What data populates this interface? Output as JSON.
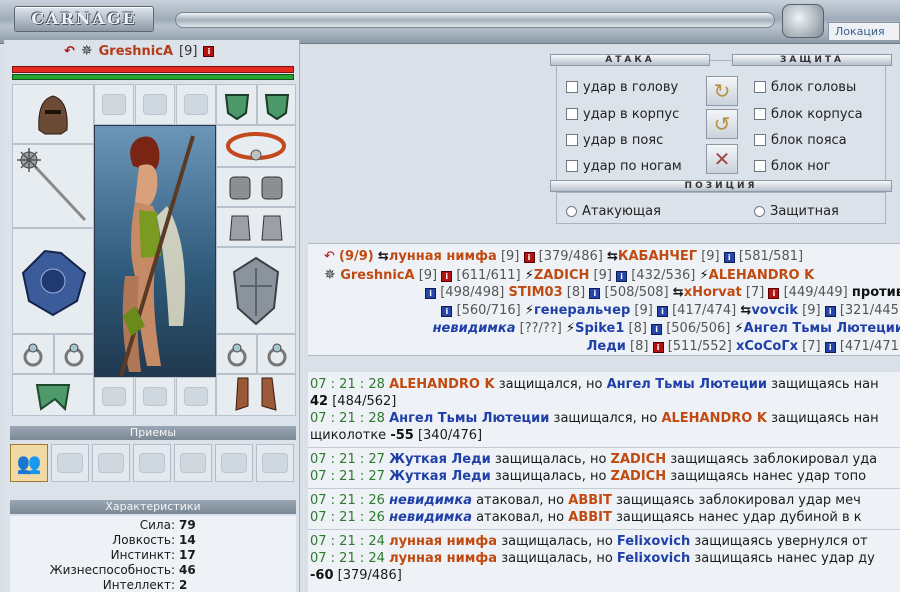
{
  "header": {
    "logo_text": "CARNAGE",
    "location_tab": "Локация"
  },
  "player": {
    "nick": "GreshnicA",
    "level": "[9]",
    "info_icon": "info-icon"
  },
  "tricks": {
    "title": "Приемы"
  },
  "stats": {
    "title": "Характеристики",
    "items": [
      {
        "name": "Сила:",
        "value": "79"
      },
      {
        "name": "Ловкость:",
        "value": "14"
      },
      {
        "name": "Инстинкт:",
        "value": "17"
      },
      {
        "name": "Жизнеспособность:",
        "value": "46"
      },
      {
        "name": "Интеллект:",
        "value": "2"
      }
    ]
  },
  "combat": {
    "attack_title": "АТАКА",
    "defense_title": "ЗАЩИТА",
    "position_title": "ПОЗИЦИЯ",
    "attacks": [
      "удар в голову",
      "удар в корпус",
      "удар в пояс",
      "удар по ногам"
    ],
    "blocks": [
      "блок головы",
      "блок корпуса",
      "блок пояса",
      "блок ног"
    ],
    "positions": [
      "Атакующая",
      "Защитная"
    ]
  },
  "participants": {
    "count": "(9/9)",
    "rows": [
      [
        "лунная нимфа",
        "[9]",
        "[379/486]",
        "КАБАНЧЕГ",
        "[9]",
        "[581/581]"
      ],
      [
        "GreshnicA",
        "[9]",
        "[611/611]",
        "ZADICH",
        "[9]",
        "[432/536]",
        "ALEHANDRO K"
      ],
      [
        "[498/498]",
        "STIM03",
        "[8]",
        "[508/508]",
        "xHorvat",
        "[7]",
        "[449/449]",
        "против"
      ],
      [
        "[560/716]",
        "генеральчер",
        "[9]",
        "[417/474]",
        "vovcik",
        "[9]",
        "[321/445]"
      ],
      [
        "невидимка",
        "[??/??]",
        "Spike1",
        "[8]",
        "[506/506]",
        "Ангел Тьмы Лютеции"
      ],
      [
        "Леди",
        "[8]",
        "[511/552]",
        "xCoCoГx",
        "[7]",
        "[471/471]"
      ]
    ]
  },
  "log": [
    {
      "time": "07 : 21 : 28",
      "a": "ALEHANDRO K",
      "t1": " защищался, но ",
      "b": "Ангел Тьмы Лютеции",
      "t2": " защищаясь нан"
    },
    {
      "line2": "42",
      "line2b": " [484/562]"
    },
    {
      "time": "07 : 21 : 28",
      "a": "Ангел Тьмы Лютеции",
      "t1": " защищался, но ",
      "b": "ALEHANDRO K",
      "t2": " защищаясь нан"
    },
    {
      "line2": "щиколотке ",
      "dmg": "-55",
      "line2b": " [340/476]"
    },
    {
      "time": "07 : 21 : 27",
      "a": "Жуткая Леди",
      "t1": " защищалась, но ",
      "b": "ZADICH",
      "t2": " защищаясь заблокировал уда"
    },
    {
      "time": "07 : 21 : 27",
      "a": "Жуткая Леди",
      "t1": " защищалась, но ",
      "b": "ZADICH",
      "t2": " защищаясь нанес удар топо"
    },
    {
      "time": "07 : 21 : 26",
      "a": "невидимка",
      "t1": " атаковал, но ",
      "b": "ABBIT",
      "t2": " защищаясь заблокировал удар меч"
    },
    {
      "time": "07 : 21 : 26",
      "a": "невидимка",
      "t1": " атаковал, но ",
      "b": "ABBIT",
      "t2": " защищаясь нанес удар дубиной в к"
    },
    {
      "time": "07 : 21 : 24",
      "a": "лунная нимфа",
      "t1": " защищалась, но ",
      "b": "Felixovich",
      "t2": " защищаясь увернулся от"
    },
    {
      "time": "07 : 21 : 24",
      "a": "лунная нимфа",
      "t1": " защищалась, но ",
      "b": "Felixovich",
      "t2": " защищаясь нанес удар ду"
    },
    {
      "dmg": "-60",
      "line2b": " [379/486]"
    }
  ]
}
